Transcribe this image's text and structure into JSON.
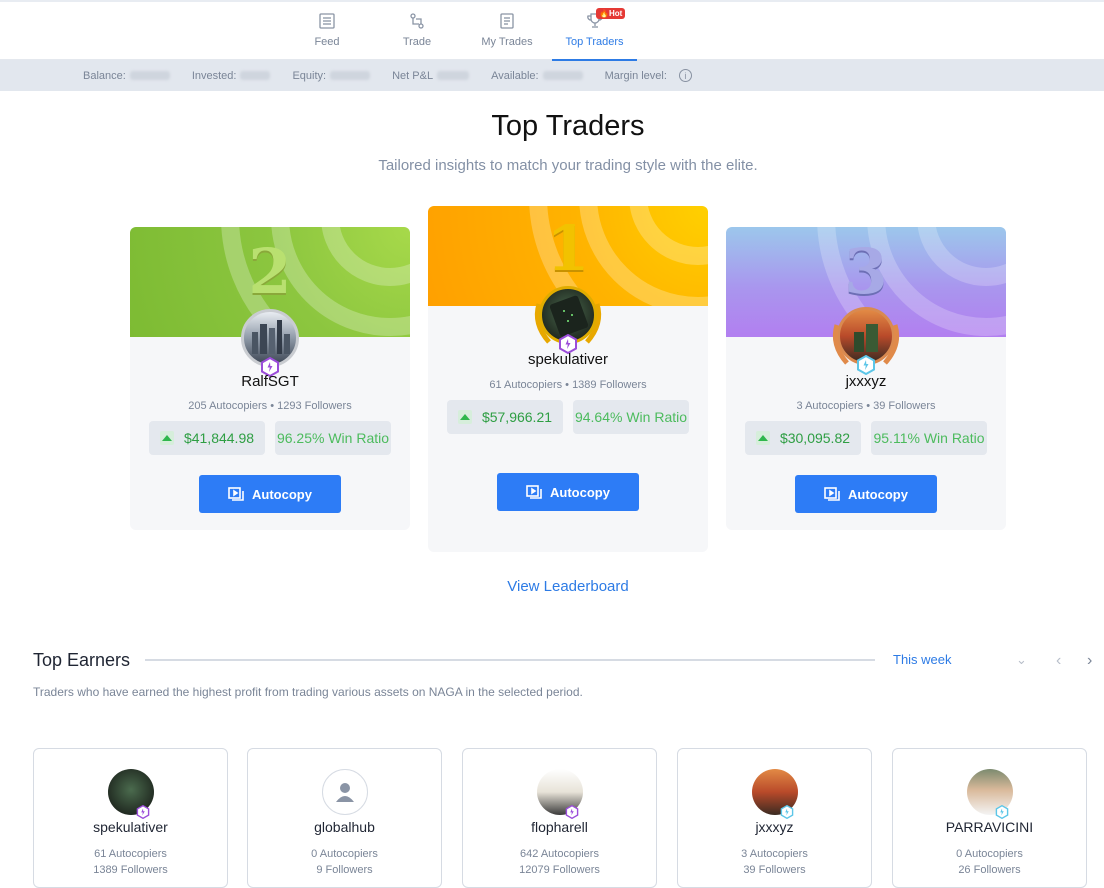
{
  "nav": {
    "tabs": [
      {
        "label": "Feed",
        "icon": "feed-icon"
      },
      {
        "label": "Trade",
        "icon": "trade-icon"
      },
      {
        "label": "My Trades",
        "icon": "my-trades-icon"
      },
      {
        "label": "Top Traders",
        "icon": "trophy-icon",
        "badge": "Hot"
      }
    ],
    "active_tab": "Top Traders"
  },
  "balance_bar": {
    "balance_label": "Balance:",
    "invested_label": "Invested:",
    "equity_label": "Equity:",
    "netpl_label": "Net P&L",
    "available_label": "Available:",
    "margin_label": "Margin level:"
  },
  "hero": {
    "title": "Top Traders",
    "subtitle": "Tailored insights to match your trading style with the elite."
  },
  "podium": [
    {
      "rank": "2",
      "name": "RalfSGT",
      "meta": "205 Autocopiers • 1293 Followers",
      "profit": "$41,844.98",
      "win": "96.25% Win Ratio",
      "button": "Autocopy"
    },
    {
      "rank": "1",
      "name": "spekulativer",
      "meta": "61 Autocopiers • 1389 Followers",
      "profit": "$57,966.21",
      "win": "94.64% Win Ratio",
      "button": "Autocopy"
    },
    {
      "rank": "3",
      "name": "jxxxyz",
      "meta": "3 Autocopiers • 39 Followers",
      "profit": "$30,095.82",
      "win": "95.11% Win Ratio",
      "button": "Autocopy"
    }
  ],
  "leaderboard_link": "View Leaderboard",
  "top_earners": {
    "title": "Top Earners",
    "period": "This week",
    "description": "Traders who have earned the highest profit from trading various assets on NAGA in the selected period.",
    "cards": [
      {
        "name": "spekulativer",
        "autocopiers": "61 Autocopiers",
        "followers": "1389 Followers"
      },
      {
        "name": "globalhub",
        "autocopiers": "0 Autocopiers",
        "followers": "9 Followers"
      },
      {
        "name": "flopharell",
        "autocopiers": "642 Autocopiers",
        "followers": "12079 Followers"
      },
      {
        "name": "jxxxyz",
        "autocopiers": "3 Autocopiers",
        "followers": "39 Followers"
      },
      {
        "name": "PARRAVICINI",
        "autocopiers": "0 Autocopiers",
        "followers": "26 Followers"
      }
    ]
  },
  "colors": {
    "accent": "#2d7be5",
    "button": "#2d7cf6",
    "profit_green": "#2e9e43",
    "gold": "#f9b400",
    "silver_green": "#8cc63f",
    "bronze_purple": "#a88ff0"
  }
}
